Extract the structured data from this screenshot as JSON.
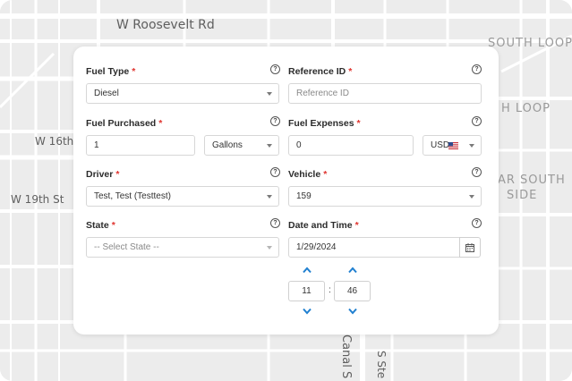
{
  "map": {
    "streets": [
      "W Roosevelt Rd",
      "SOUTH LOOP",
      "H LOOP",
      "W 16th",
      "W 19th St",
      "AR SOUTH",
      "SIDE",
      "Canal S",
      "S Ste"
    ]
  },
  "form": {
    "fuel_type": {
      "label": "Fuel Type",
      "value": "Diesel"
    },
    "reference_id": {
      "label": "Reference ID",
      "placeholder": "Reference ID"
    },
    "fuel_purchased": {
      "label": "Fuel Purchased",
      "value": "1",
      "unit": "Gallons"
    },
    "fuel_expenses": {
      "label": "Fuel Expenses",
      "value": "0",
      "currency": "USD"
    },
    "driver": {
      "label": "Driver",
      "value": "Test, Test (Testtest)"
    },
    "vehicle": {
      "label": "Vehicle",
      "value": "159"
    },
    "state": {
      "label": "State",
      "placeholder": "-- Select State --"
    },
    "date_time": {
      "label": "Date and Time",
      "date": "1/29/2024",
      "hour": "11",
      "minute": "46",
      "separator": ":"
    }
  },
  "required_marker": "*",
  "help_glyph": "?",
  "colors": {
    "required": "#e0342f",
    "stepper_arrow": "#1f7fd0",
    "map_bg": "#ececec"
  },
  "icons": {
    "help": "question-circle-icon",
    "dropdown": "caret-down-icon",
    "calendar": "calendar-icon",
    "flag": "us-flag-icon",
    "up": "chevron-up-icon",
    "down": "chevron-down-icon"
  }
}
